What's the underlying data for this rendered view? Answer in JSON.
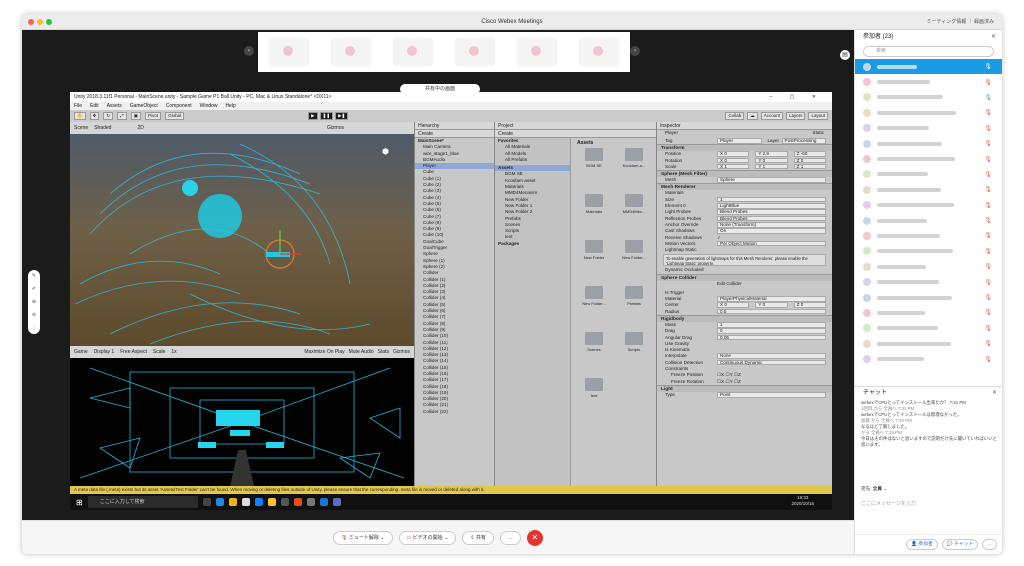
{
  "window": {
    "title": "Cisco Webex Meetings",
    "right_status": "ミーティング情報 ｜ 録画済み"
  },
  "share": {
    "banner": "共有中の画面"
  },
  "unity": {
    "title": "Unity 2018.3.11f1 Personal - MainScene.unity - Sample Game P1 Ball Unity - PC, Mac & Linux Standalone* <DX11>",
    "menu": [
      "File",
      "Edit",
      "Assets",
      "GameObject",
      "Component",
      "Window",
      "Help"
    ],
    "tools": {
      "pivot": "Pivot",
      "global": "Global",
      "collab": "Collab",
      "account": "Account",
      "layers": "Layers",
      "layout": "Layout"
    },
    "scene": {
      "tab": "Scene",
      "shaded": "Shaded",
      "mode2d": "2D",
      "gizmos": "Gizmos"
    },
    "game": {
      "tab": "Game",
      "display": "Display 1",
      "aspect": "Free Aspect",
      "scale": "Scale",
      "scale_val": "1x",
      "opts": [
        "Maximize On Play",
        "Mute Audio",
        "Stats",
        "Gizmos"
      ]
    },
    "hierarchy": {
      "tab": "Hierarchy",
      "create": "Create",
      "items": [
        "MainScene*",
        "Main Camera",
        "wire_stage1_blue",
        "BGMAudio",
        "Player",
        "Cube",
        "Cube (1)",
        "Cube (2)",
        "Cube (3)",
        "Cube (4)",
        "Cube (5)",
        "Cube (6)",
        "Cube (7)",
        "Cube (8)",
        "Cube (9)",
        "Cube (10)",
        "GoalCube",
        "GoalTrigger",
        "Sphere",
        "Sphere (1)",
        "Sphere (2)",
        "Collider",
        "Collider (1)",
        "Collider (2)",
        "Collider (3)",
        "Collider (4)",
        "Collider (5)",
        "Collider (6)",
        "Collider (7)",
        "Collider (8)",
        "Collider (9)",
        "Collider (10)",
        "Collider (11)",
        "Collider (12)",
        "Collider (13)",
        "Collider (14)",
        "Collider (15)",
        "Collider (16)",
        "Collider (17)",
        "Collider (18)",
        "Collider (19)",
        "Collider (20)",
        "Collider (21)",
        "Collider (22)"
      ]
    },
    "project": {
      "tab": "Project",
      "create": "Create",
      "tree": [
        "Favorites",
        "All Materials",
        "All Models",
        "All Prefabs",
        "Assets",
        "BGM SE",
        "Kcosfam-asset",
        "Materials",
        "MMD4Mecanim",
        "New Folder",
        "New Folder 1",
        "New Folder 2",
        "Prefabs",
        "Scenes",
        "Scripts",
        "text",
        "Packages"
      ],
      "crumb": "Assets",
      "folders": [
        "BGM SE",
        "Kcosfam-a...",
        "Materials",
        "MMD4Mec...",
        "New Folder",
        "New Folder...",
        "New Folder...",
        "Prefabs",
        "Scenes",
        "Scripts",
        "text"
      ]
    },
    "inspector": {
      "tab": "Inspector",
      "name": "Player",
      "static": "Static",
      "tag": "Player",
      "layer": "PostProcessing",
      "transform": {
        "title": "Transform",
        "position": [
          "X 0",
          "Y 2.9",
          "Z -60"
        ],
        "rotation": [
          "X 0",
          "Y 0",
          "Z 0"
        ],
        "scale": [
          "X 1",
          "Y 1",
          "Z 1"
        ]
      },
      "mesh_filter": {
        "title": "Sphere (Mesh Filter)",
        "mesh": "Sphere"
      },
      "renderer": {
        "title": "Mesh Renderer",
        "materials": "Materials",
        "size": "1",
        "element0": "LightBlue",
        "light_probes": "Blend Probes",
        "reflection_probes": "Blend Probes",
        "anchor": "None (Transform)",
        "cast_shadows": "On",
        "receive_shadows": "✓",
        "motion_vectors": "Per Object Motion",
        "lightmap_static": "Lightmap Static",
        "info": "To enable generation of lightmaps for this Mesh Renderer, please enable the 'Lightmap Static' property.",
        "dynamic": "Dynamic Occluded"
      },
      "collider": {
        "title": "Sphere Collider",
        "edit": "Edit Collider",
        "is_trigger": "Is Trigger",
        "material": "PlayerPhysicalMaterial",
        "center": [
          "X 0",
          "Y 0",
          "Z 0"
        ],
        "radius": "0.5"
      },
      "rigidbody": {
        "title": "Rigidbody",
        "mass": "1",
        "drag": "0",
        "angular_drag": "0.05",
        "use_gravity": "Use Gravity",
        "is_kinematic": "Is Kinematic",
        "interpolate": "None",
        "collision": "Continuous Dynamic",
        "constraints": "Constraints",
        "freeze_pos": "Freeze Position",
        "freeze_rot": "Freeze Rotation"
      },
      "light": {
        "title": "Light",
        "type": "Point"
      }
    },
    "warning": "A meta data file (.meta) exists but its asset 'Assets/Test Folder' can't be found. When moving or deleting files outside of Unity, please ensure that the corresponding .meta file is moved or deleted along with it."
  },
  "taskbar": {
    "search": "ここに入力して検索",
    "time": "19:33",
    "date": "2020/10/16"
  },
  "controls": {
    "mute": "ミュート解除",
    "video": "ビデオの開始",
    "share": "共有",
    "more": "…"
  },
  "panel": {
    "participants_title": "参加者 (23)",
    "search": "検索",
    "participant_count": 20,
    "chat_title": "チャット",
    "chat": [
      "webexでCPUとってインストール出来たか？ 7:31 PM",
      "1回目 から 全員へ 7:31 PM",
      "webexでCPUとってインストールは無理なかった。",
      "加藤 から 全員へ 7:33 PM",
      "なるほど了解しました。",
      "から 全員へ 7:33 PM",
      "今日はその件はないと思いますので説明だけ先に聞いていればいいと思います。"
    ],
    "to_label": "宛先:",
    "to": "全員",
    "input_placeholder": "ここにメッセージを入力",
    "btn_participants": "参加者",
    "btn_chat": "チャット"
  }
}
